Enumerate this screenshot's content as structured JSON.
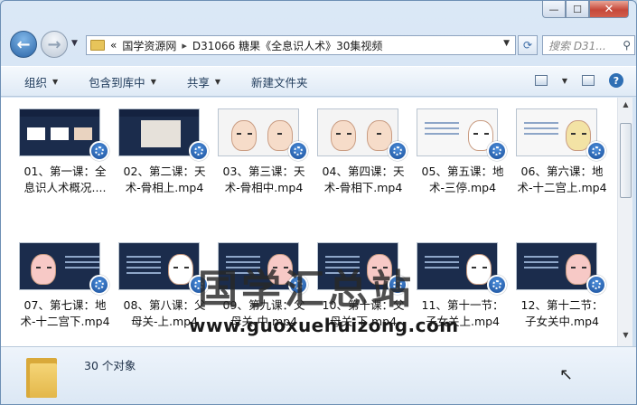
{
  "window": {
    "minimize_label": "—",
    "maximize_label": "☐",
    "close_label": "✕"
  },
  "address": {
    "prefix": "«",
    "crumbs": [
      "国学资源网",
      "D31066 糖果《全息识人术》30集视频"
    ]
  },
  "search": {
    "placeholder": "搜索 D31..."
  },
  "toolbar": {
    "organize": "组织",
    "include_library": "包含到库中",
    "share": "共享",
    "new_folder": "新建文件夹"
  },
  "files": [
    {
      "line1": "01、第一课：全",
      "line2": "息识人术概况...."
    },
    {
      "line1": "02、第二课：天",
      "line2": "术-骨相上.mp4"
    },
    {
      "line1": "03、第三课：天",
      "line2": "术-骨相中.mp4"
    },
    {
      "line1": "04、第四课：天",
      "line2": "术-骨相下.mp4"
    },
    {
      "line1": "05、第五课：地",
      "line2": "术-三停.mp4"
    },
    {
      "line1": "06、第六课：地",
      "line2": "术-十二宫上.mp4"
    },
    {
      "line1": "07、第七课：地",
      "line2": "术-十二宫下.mp4"
    },
    {
      "line1": "08、第八课：父",
      "line2": "母关-上.mp4"
    },
    {
      "line1": "09、第九课：父",
      "line2": "母关-中.mp4"
    },
    {
      "line1": "10、第十课：父",
      "line2": "母关-下.mp4"
    },
    {
      "line1": "11、第十一节：",
      "line2": "子女关上.mp4"
    },
    {
      "line1": "12、第十二节：",
      "line2": "子女关中.mp4"
    }
  ],
  "watermark": {
    "title": "国学汇总站",
    "url": "www.guoxuehuizong.com"
  },
  "status": {
    "count_text": "30 个对象"
  }
}
